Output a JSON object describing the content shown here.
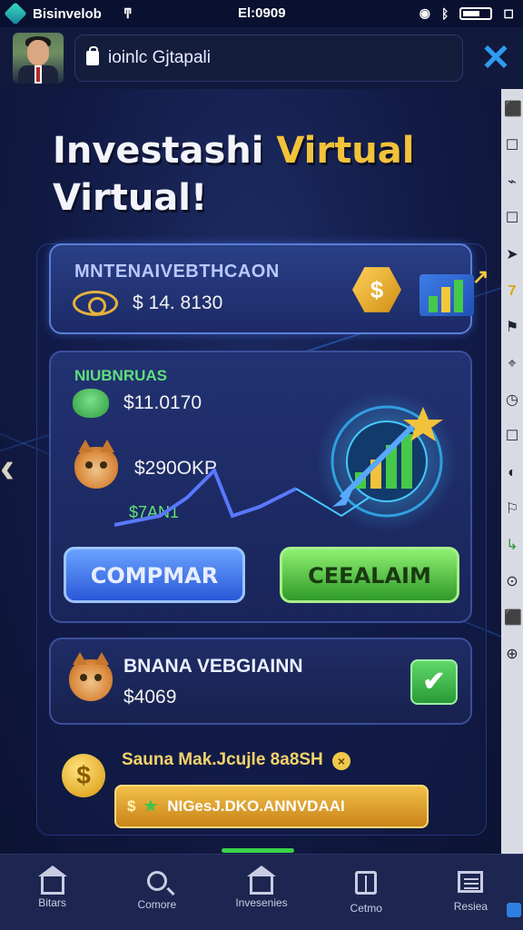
{
  "status_bar": {
    "app_name": "Bisinvelob",
    "time": "El:0909",
    "wifi_glyph": "ͳ"
  },
  "header": {
    "search_text": "ioinlc Gjtapali",
    "close_label": "✕"
  },
  "hero": {
    "title_part1": "Investashi ",
    "title_accent": "Virtual",
    "title_line2": "Virtual!"
  },
  "card1": {
    "title": "MNTENAIVEBTHCAON",
    "value": "$ 14. 8130",
    "coin_symbol": "$"
  },
  "card2": {
    "label": "NIUBNRUAS",
    "value1": "$11.0170",
    "value2": "$290OKP",
    "value3": "$7AN1",
    "compare_button": "COMPMAR",
    "claim_button": "CEEALAIM"
  },
  "card3": {
    "title": "BNANA VEBGIAINN",
    "value": "$4069",
    "check": "✔"
  },
  "promo": {
    "coin": "$",
    "title": "Sauna Mak.Jcujle 8a8SH",
    "close": "×",
    "button_dollar": "$",
    "button_star": "★",
    "button_text": "NIGesJ.DKO.ANNVDAAI"
  },
  "side_rail": [
    "⬛",
    "☐",
    "⌁",
    "☐",
    "➤",
    "7",
    "⚑",
    "⌖",
    "◷",
    "☐",
    "◐",
    "⚐",
    "↳",
    "⊙",
    "⬛",
    "⊕"
  ],
  "left_arrow": "‹",
  "bottom_nav": [
    {
      "label": "Bitars",
      "icon": "home-icon"
    },
    {
      "label": "Comore",
      "icon": "search-icon"
    },
    {
      "label": "Invesenies",
      "icon": "house-icon"
    },
    {
      "label": "Cetmo",
      "icon": "book-icon"
    },
    {
      "label": "Resiea",
      "icon": "news-icon"
    }
  ],
  "chart_colors": {
    "trend_line": "#5a78ff",
    "glow": "#46c9ff",
    "bars": "#45c94a",
    "star": "#f2c23a"
  }
}
